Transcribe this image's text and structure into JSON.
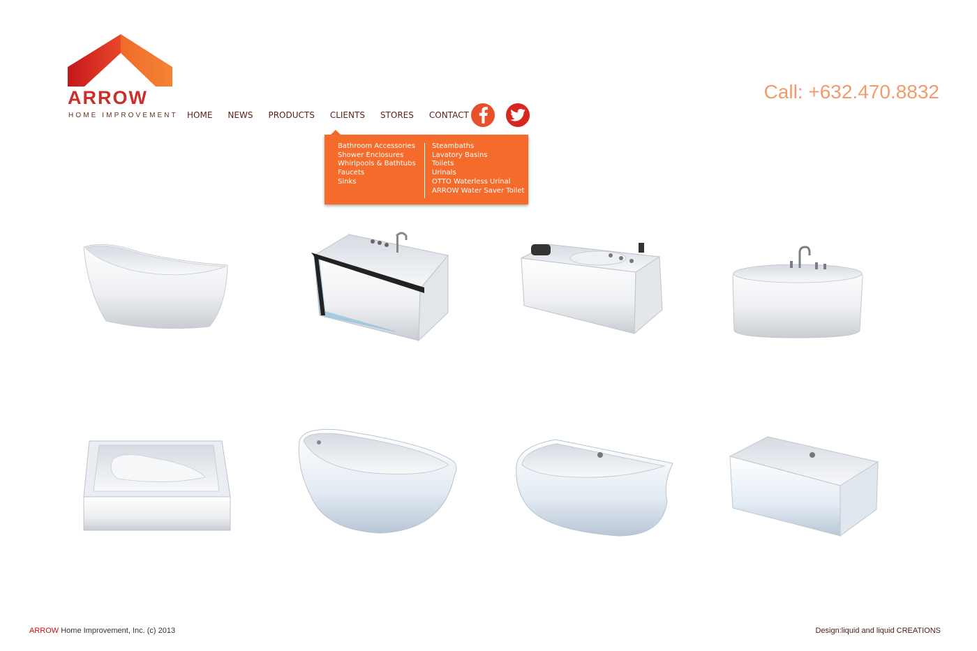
{
  "logo": {
    "word": "ARROW",
    "subtitle": "HOME IMPROVEMENT"
  },
  "nav": {
    "items": [
      {
        "label": "HOME"
      },
      {
        "label": "NEWS"
      },
      {
        "label": "PRODUCTS"
      },
      {
        "label": "CLIENTS"
      },
      {
        "label": "STORES"
      },
      {
        "label": "CONTACT US"
      }
    ],
    "active": "CLIENTS"
  },
  "social": [
    {
      "icon": "facebook-icon",
      "color": "#e8502a"
    },
    {
      "icon": "twitter-icon",
      "color": "#d7261f"
    }
  ],
  "phone": "Call: +632.470.8832",
  "dropdown": {
    "color": "#f56b2b",
    "col1": [
      "Bathroom Accessories",
      "Shower Enclosures",
      "Whirlpools & Bathtubs",
      "Faucets",
      "Sinks"
    ],
    "col2": [
      "Steambaths",
      "Lavatory Basins",
      "Toilets",
      "Urinals",
      "OTTO Waterless Urinal",
      "ARROW Water Saver Toilet"
    ]
  },
  "products": [
    {
      "icon": "freestanding-slipper-bathtub-image"
    },
    {
      "icon": "glass-panel-whirlpool-bathtub-image"
    },
    {
      "icon": "jacuzzi-whirlpool-bathtub-image"
    },
    {
      "icon": "oval-freestanding-bathtub-with-faucet-image"
    },
    {
      "icon": "rectangular-alcove-bathtub-image"
    },
    {
      "icon": "rounded-freestanding-bathtub-image"
    },
    {
      "icon": "corner-back-to-wall-bathtub-image"
    },
    {
      "icon": "rectangular-drop-in-bathtub-image"
    }
  ],
  "footer": {
    "brand": "ARROW",
    "copyright": " Home Improvement, Inc. (c) 2013",
    "credit": "Design:liquid and liquid CREATIONS"
  },
  "colors": {
    "brand_red": "#c9302c",
    "accent_orange": "#f56b2b",
    "phone": "#f39b6d"
  }
}
